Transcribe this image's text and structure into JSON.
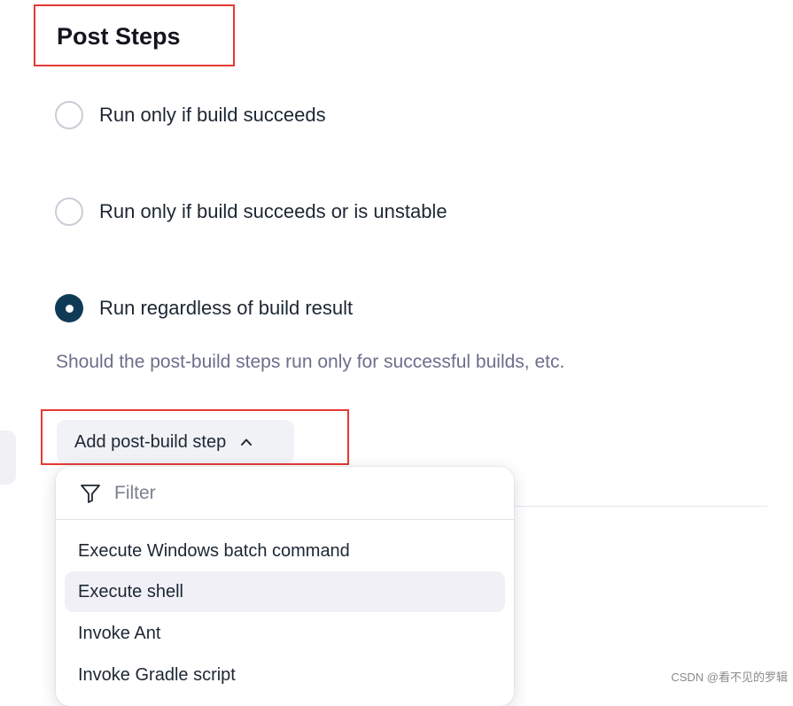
{
  "section": {
    "title": "Post Steps"
  },
  "radio_options": [
    {
      "label": "Run only if build succeeds",
      "checked": false
    },
    {
      "label": "Run only if build succeeds or is unstable",
      "checked": false
    },
    {
      "label": "Run regardless of build result",
      "checked": true
    }
  ],
  "help_text": "Should the post-build steps run only for successful builds, etc.",
  "add_step_button": {
    "label": "Add post-build step",
    "icon": "chevron-up-icon"
  },
  "dropdown": {
    "filter": {
      "placeholder": "Filter",
      "value": "",
      "icon": "filter-icon"
    },
    "items": [
      {
        "label": "Execute Windows batch command",
        "hovered": false
      },
      {
        "label": "Execute shell",
        "hovered": true
      },
      {
        "label": "Invoke Ant",
        "hovered": false
      },
      {
        "label": "Invoke Gradle script",
        "hovered": false
      }
    ]
  },
  "watermark": "CSDN @看不见的罗辑",
  "colors": {
    "highlight": "#e53935",
    "radio_checked": "#0f3b57",
    "help_text": "#6b6f8b",
    "button_bg": "#f1f2f6",
    "hover_bg": "#f0f0f6"
  }
}
